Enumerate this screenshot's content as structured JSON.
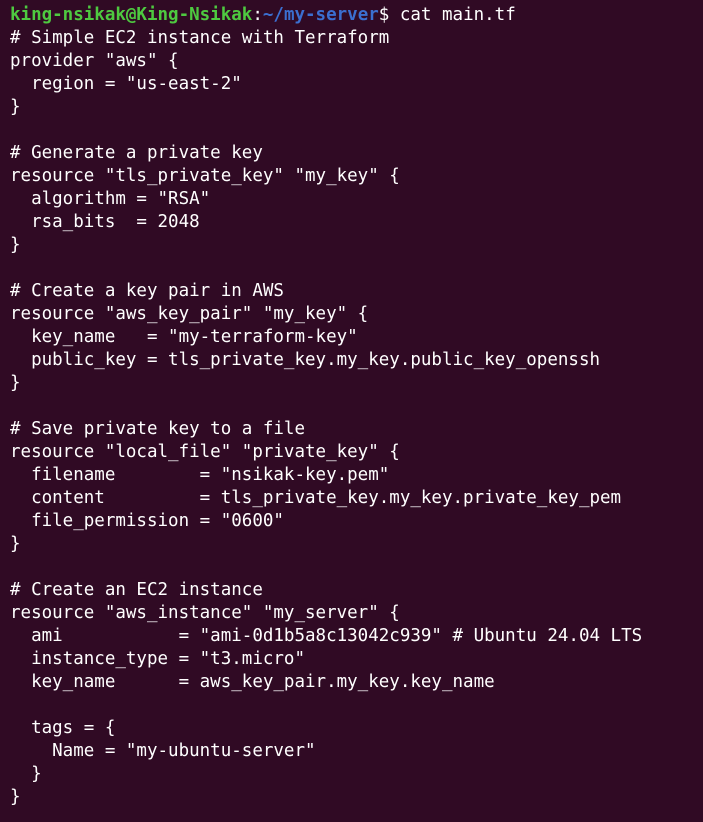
{
  "prompt": {
    "user_host": "king-nsikak@King-Nsikak",
    "separator": ":",
    "path": "~/my-server",
    "symbol": "$ ",
    "command": "cat main.tf"
  },
  "file_lines": [
    "# Simple EC2 instance with Terraform",
    "provider \"aws\" {",
    "  region = \"us-east-2\"",
    "}",
    "",
    "# Generate a private key",
    "resource \"tls_private_key\" \"my_key\" {",
    "  algorithm = \"RSA\"",
    "  rsa_bits  = 2048",
    "}",
    "",
    "# Create a key pair in AWS",
    "resource \"aws_key_pair\" \"my_key\" {",
    "  key_name   = \"my-terraform-key\"",
    "  public_key = tls_private_key.my_key.public_key_openssh",
    "}",
    "",
    "# Save private key to a file",
    "resource \"local_file\" \"private_key\" {",
    "  filename        = \"nsikak-key.pem\"",
    "  content         = tls_private_key.my_key.private_key_pem",
    "  file_permission = \"0600\"",
    "}",
    "",
    "# Create an EC2 instance",
    "resource \"aws_instance\" \"my_server\" {",
    "  ami           = \"ami-0d1b5a8c13042c939\" # Ubuntu 24.04 LTS",
    "  instance_type = \"t3.micro\"",
    "  key_name      = aws_key_pair.my_key.key_name",
    "",
    "  tags = {",
    "    Name = \"my-ubuntu-server\"",
    "  }",
    "}"
  ]
}
